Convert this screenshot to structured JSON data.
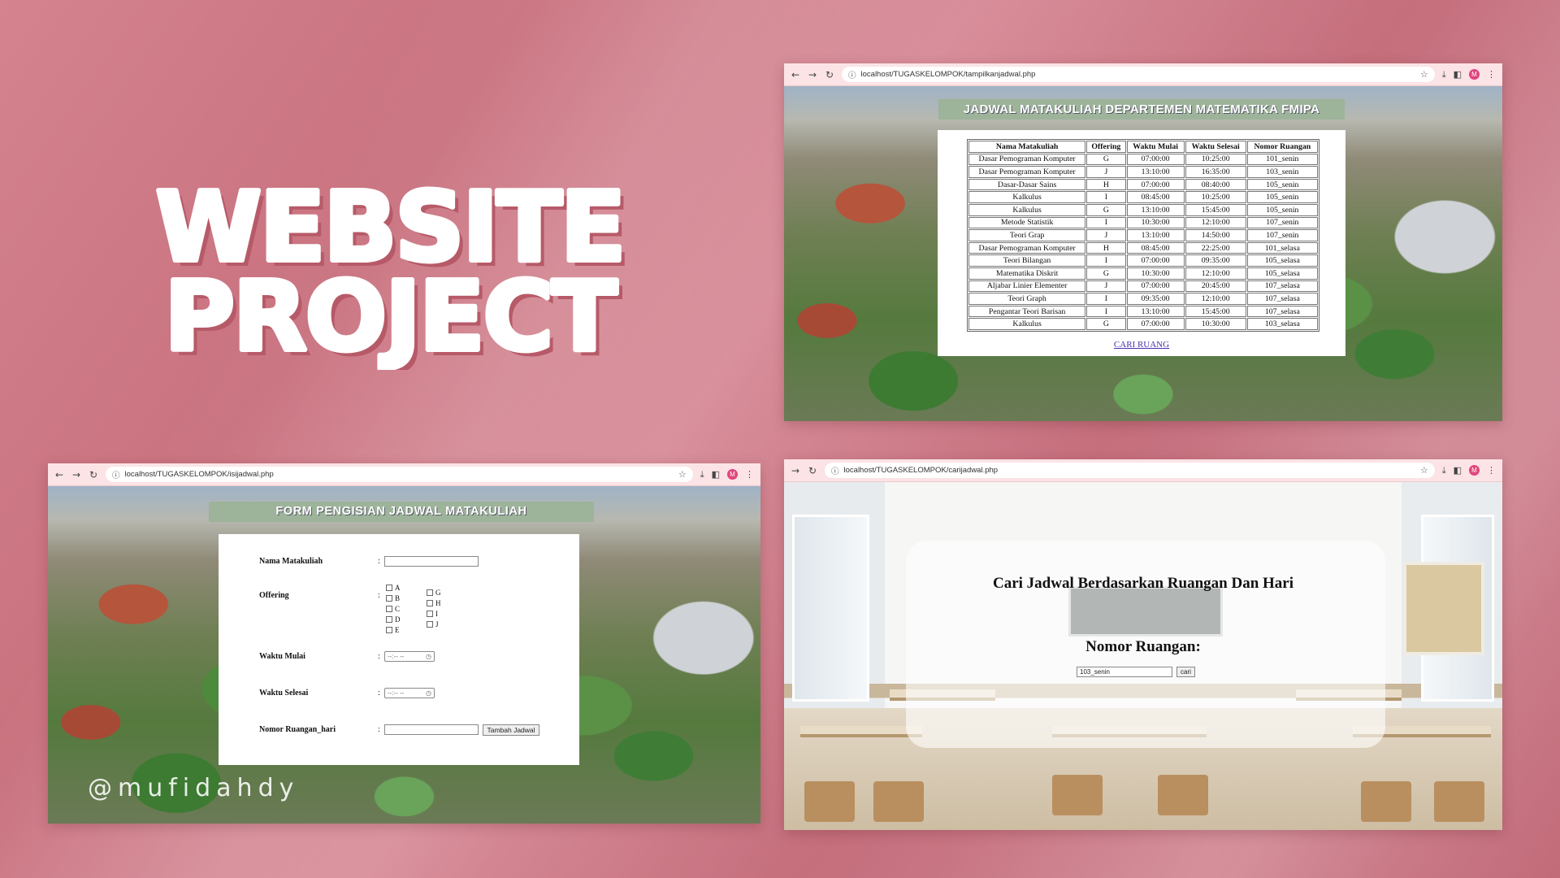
{
  "hero": {
    "line1": "WEBSITE",
    "line2": "PROJECT"
  },
  "watermark": "@mufidahdy",
  "colors": {
    "background": "#d07d8a",
    "title_bar": "#9db39a",
    "link": "#4a2fb0",
    "browser_bar": "#fbe3e6"
  },
  "window_schedule": {
    "url": "localhost/TUGASKELOMPOK/tampilkanjadwal.php",
    "title": "JADWAL MATAKULIAH DEPARTEMEN MATEMATIKA FMIPA",
    "columns": [
      "Nama Matakuliah",
      "Offering",
      "Waktu Mulai",
      "Waktu Selesai",
      "Nomor Ruangan"
    ],
    "rows": [
      [
        "Dasar Pemograman Komputer",
        "G",
        "07:00:00",
        "10:25:00",
        "101_senin"
      ],
      [
        "Dasar Pemograman Komputer",
        "J",
        "13:10:00",
        "16:35:00",
        "103_senin"
      ],
      [
        "Dasar-Dasar Sains",
        "H",
        "07:00:00",
        "08:40:00",
        "105_senin"
      ],
      [
        "Kalkulus",
        "I",
        "08:45:00",
        "10:25:00",
        "105_senin"
      ],
      [
        "Kalkulus",
        "G",
        "13:10:00",
        "15:45:00",
        "105_senin"
      ],
      [
        "Metode Statistik",
        "I",
        "10:30:00",
        "12:10:00",
        "107_senin"
      ],
      [
        "Teori Grap",
        "J",
        "13:10:00",
        "14:50:00",
        "107_senin"
      ],
      [
        "Dasar Pemograman Komputer",
        "H",
        "08:45:00",
        "22:25:00",
        "101_selasa"
      ],
      [
        "Teori Bilangan",
        "I",
        "07:00:00",
        "09:35:00",
        "105_selasa"
      ],
      [
        "Matematika Diskrit",
        "G",
        "10:30:00",
        "12:10:00",
        "105_selasa"
      ],
      [
        "Aljabar Linier Elementer",
        "J",
        "07:00:00",
        "20:45:00",
        "107_selasa"
      ],
      [
        "Teori Graph",
        "I",
        "09:35:00",
        "12:10:00",
        "107_selasa"
      ],
      [
        "Pengantar Teori Barisan",
        "I",
        "13:10:00",
        "15:45:00",
        "107_selasa"
      ],
      [
        "Kalkulus",
        "G",
        "07:00:00",
        "10:30:00",
        "103_selasa"
      ]
    ],
    "link": "CARI RUANG"
  },
  "window_form": {
    "url": "localhost/TUGASKELOMPOK/isijadwal.php",
    "title": "FORM PENGISIAN JADWAL MATAKULIAH",
    "labels": {
      "nama": "Nama Matakuliah",
      "offering": "Offering",
      "mulai": "Waktu Mulai",
      "selesai": "Waktu Selesai",
      "ruangan": "Nomor Ruangan_hari"
    },
    "colon": ":",
    "offering_options_left": [
      "A",
      "B",
      "C",
      "D",
      "E"
    ],
    "offering_options_right": [
      "G",
      "H",
      "I",
      "J"
    ],
    "time_placeholder": "--:-- --",
    "submit": "Tambah Jadwal"
  },
  "window_search": {
    "url": "localhost/TUGASKELOMPOK/carijadwal.php",
    "heading": "Cari Jadwal Berdasarkan Ruangan Dan Hari",
    "subheading": "Nomor Ruangan:",
    "input_value": "103_senin",
    "button": "cari"
  },
  "icons": {
    "back": "←",
    "forward": "→",
    "reload": "↻",
    "info": "ⓘ",
    "star": "☆",
    "download": "⤓",
    "sidebar": "◧",
    "menu": "⋮",
    "avatar": "M",
    "clock": "◷"
  }
}
